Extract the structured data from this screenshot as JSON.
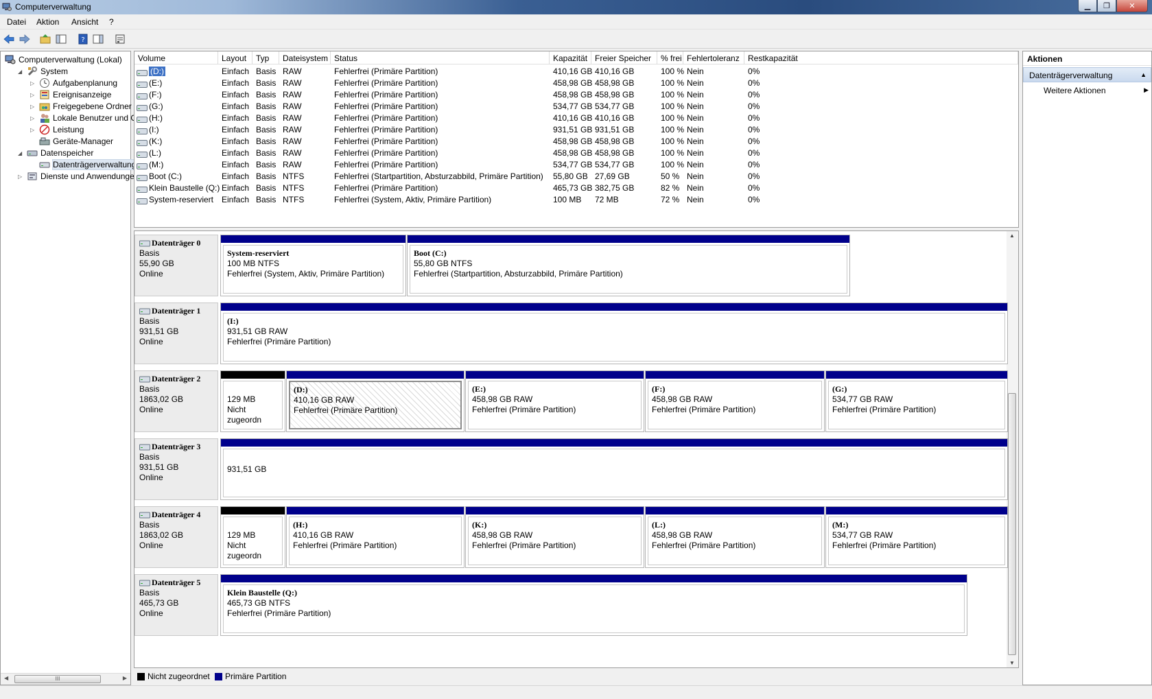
{
  "window": {
    "title": "Computerverwaltung"
  },
  "menu": {
    "items": [
      "Datei",
      "Aktion",
      "Ansicht",
      "?"
    ]
  },
  "tree": {
    "items": [
      {
        "label": "Computerverwaltung (Lokal)",
        "level": 0,
        "expander": "",
        "icon": "computer-icon"
      },
      {
        "label": "System",
        "level": 1,
        "expander": "◢",
        "icon": "tools-icon"
      },
      {
        "label": "Aufgabenplanung",
        "level": 2,
        "expander": "▷",
        "icon": "clock-icon"
      },
      {
        "label": "Ereignisanzeige",
        "level": 2,
        "expander": "▷",
        "icon": "event-viewer-icon"
      },
      {
        "label": "Freigegebene Ordner",
        "level": 2,
        "expander": "▷",
        "icon": "shared-folder-icon"
      },
      {
        "label": "Lokale Benutzer und Gr",
        "level": 2,
        "expander": "▷",
        "icon": "users-icon"
      },
      {
        "label": "Leistung",
        "level": 2,
        "expander": "▷",
        "icon": "performance-icon"
      },
      {
        "label": "Geräte-Manager",
        "level": 2,
        "expander": "",
        "icon": "device-manager-icon"
      },
      {
        "label": "Datenspeicher",
        "level": 1,
        "expander": "◢",
        "icon": "storage-icon"
      },
      {
        "label": "Datenträgerverwaltung",
        "level": 2,
        "expander": "",
        "icon": "disk-management-icon",
        "selected": true
      },
      {
        "label": "Dienste und Anwendungen",
        "level": 1,
        "expander": "▷",
        "icon": "services-icon"
      }
    ],
    "scroll_thumb_label": "III"
  },
  "volumes": {
    "columns": [
      "Volume",
      "Layout",
      "Typ",
      "Dateisystem",
      "Status",
      "Kapazität",
      "Freier Speicher",
      "% frei",
      "Fehlertoleranz",
      "Restkapazität"
    ],
    "rows": [
      {
        "volume": "(D:)",
        "layout": "Einfach",
        "typ": "Basis",
        "fs": "RAW",
        "status": "Fehlerfrei (Primäre Partition)",
        "cap": "410,16 GB",
        "free": "410,16 GB",
        "pct": "100 %",
        "ft": "Nein",
        "rest": "0%",
        "selected": true
      },
      {
        "volume": "(E:)",
        "layout": "Einfach",
        "typ": "Basis",
        "fs": "RAW",
        "status": "Fehlerfrei (Primäre Partition)",
        "cap": "458,98 GB",
        "free": "458,98 GB",
        "pct": "100 %",
        "ft": "Nein",
        "rest": "0%"
      },
      {
        "volume": "(F:)",
        "layout": "Einfach",
        "typ": "Basis",
        "fs": "RAW",
        "status": "Fehlerfrei (Primäre Partition)",
        "cap": "458,98 GB",
        "free": "458,98 GB",
        "pct": "100 %",
        "ft": "Nein",
        "rest": "0%"
      },
      {
        "volume": "(G:)",
        "layout": "Einfach",
        "typ": "Basis",
        "fs": "RAW",
        "status": "Fehlerfrei (Primäre Partition)",
        "cap": "534,77 GB",
        "free": "534,77 GB",
        "pct": "100 %",
        "ft": "Nein",
        "rest": "0%"
      },
      {
        "volume": "(H:)",
        "layout": "Einfach",
        "typ": "Basis",
        "fs": "RAW",
        "status": "Fehlerfrei (Primäre Partition)",
        "cap": "410,16 GB",
        "free": "410,16 GB",
        "pct": "100 %",
        "ft": "Nein",
        "rest": "0%"
      },
      {
        "volume": "(I:)",
        "layout": "Einfach",
        "typ": "Basis",
        "fs": "RAW",
        "status": "Fehlerfrei (Primäre Partition)",
        "cap": "931,51 GB",
        "free": "931,51 GB",
        "pct": "100 %",
        "ft": "Nein",
        "rest": "0%"
      },
      {
        "volume": "(K:)",
        "layout": "Einfach",
        "typ": "Basis",
        "fs": "RAW",
        "status": "Fehlerfrei (Primäre Partition)",
        "cap": "458,98 GB",
        "free": "458,98 GB",
        "pct": "100 %",
        "ft": "Nein",
        "rest": "0%"
      },
      {
        "volume": "(L:)",
        "layout": "Einfach",
        "typ": "Basis",
        "fs": "RAW",
        "status": "Fehlerfrei (Primäre Partition)",
        "cap": "458,98 GB",
        "free": "458,98 GB",
        "pct": "100 %",
        "ft": "Nein",
        "rest": "0%"
      },
      {
        "volume": "(M:)",
        "layout": "Einfach",
        "typ": "Basis",
        "fs": "RAW",
        "status": "Fehlerfrei (Primäre Partition)",
        "cap": "534,77 GB",
        "free": "534,77 GB",
        "pct": "100 %",
        "ft": "Nein",
        "rest": "0%"
      },
      {
        "volume": "Boot (C:)",
        "layout": "Einfach",
        "typ": "Basis",
        "fs": "NTFS",
        "status": "Fehlerfrei (Startpartition, Absturzabbild, Primäre Partition)",
        "cap": "55,80 GB",
        "free": "27,69 GB",
        "pct": "50 %",
        "ft": "Nein",
        "rest": "0%"
      },
      {
        "volume": "Klein Baustelle (Q:)",
        "layout": "Einfach",
        "typ": "Basis",
        "fs": "NTFS",
        "status": "Fehlerfrei (Primäre Partition)",
        "cap": "465,73 GB",
        "free": "382,75 GB",
        "pct": "82 %",
        "ft": "Nein",
        "rest": "0%"
      },
      {
        "volume": "System-reserviert",
        "layout": "Einfach",
        "typ": "Basis",
        "fs": "NTFS",
        "status": "Fehlerfrei (System, Aktiv, Primäre Partition)",
        "cap": "100 MB",
        "free": "72 MB",
        "pct": "72 %",
        "ft": "Nein",
        "rest": "0%"
      }
    ]
  },
  "disks": [
    {
      "name": "Datenträger 0",
      "type": "Basis",
      "size": "55,90 GB",
      "state": "Online",
      "partitions": [
        {
          "name": "System-reserviert",
          "size": "100 MB NTFS",
          "status": "Fehlerfrei (System, Aktiv, Primäre Partition)",
          "bar": "primary"
        },
        {
          "name": "Boot  (C:)",
          "size": "55,80 GB NTFS",
          "status": "Fehlerfrei (Startpartition, Absturzabbild, Primäre Partition)",
          "bar": "primary"
        }
      ]
    },
    {
      "name": "Datenträger 1",
      "type": "Basis",
      "size": "931,51 GB",
      "state": "Online",
      "partitions": [
        {
          "name": "(I:)",
          "size": "931,51 GB RAW",
          "status": "Fehlerfrei (Primäre Partition)",
          "bar": "primary"
        }
      ]
    },
    {
      "name": "Datenträger 2",
      "type": "Basis",
      "size": "1863,02 GB",
      "state": "Online",
      "partitions": [
        {
          "name": "",
          "size": "129 MB",
          "status": "Nicht zugeordn",
          "bar": "unallocated"
        },
        {
          "name": "(D:)",
          "size": "410,16 GB RAW",
          "status": "Fehlerfrei (Primäre Partition)",
          "bar": "primary",
          "selected": true
        },
        {
          "name": "(E:)",
          "size": "458,98 GB RAW",
          "status": "Fehlerfrei (Primäre Partition)",
          "bar": "primary"
        },
        {
          "name": "(F:)",
          "size": "458,98 GB RAW",
          "status": "Fehlerfrei (Primäre Partition)",
          "bar": "primary"
        },
        {
          "name": "(G:)",
          "size": "534,77 GB RAW",
          "status": "Fehlerfrei (Primäre Partition)",
          "bar": "primary"
        }
      ]
    },
    {
      "name": "Datenträger 3",
      "type": "Basis",
      "size": "931,51 GB",
      "state": "Online",
      "partitions": [
        {
          "name": "",
          "size": "931,51 GB",
          "status": "",
          "bar": "primary"
        }
      ]
    },
    {
      "name": "Datenträger 4",
      "type": "Basis",
      "size": "1863,02 GB",
      "state": "Online",
      "partitions": [
        {
          "name": "",
          "size": "129 MB",
          "status": "Nicht zugeordn",
          "bar": "unallocated"
        },
        {
          "name": "(H:)",
          "size": "410,16 GB RAW",
          "status": "Fehlerfrei (Primäre Partition)",
          "bar": "primary"
        },
        {
          "name": "(K:)",
          "size": "458,98 GB RAW",
          "status": "Fehlerfrei (Primäre Partition)",
          "bar": "primary"
        },
        {
          "name": "(L:)",
          "size": "458,98 GB RAW",
          "status": "Fehlerfrei (Primäre Partition)",
          "bar": "primary"
        },
        {
          "name": "(M:)",
          "size": "534,77 GB RAW",
          "status": "Fehlerfrei (Primäre Partition)",
          "bar": "primary"
        }
      ]
    },
    {
      "name": "Datenträger 5",
      "type": "Basis",
      "size": "465,73 GB",
      "state": "Online",
      "partitions": [
        {
          "name": "Klein Baustelle  (Q:)",
          "size": "465,73 GB NTFS",
          "status": "Fehlerfrei (Primäre Partition)",
          "bar": "primary"
        }
      ]
    }
  ],
  "legend": {
    "unallocated": "Nicht zugeordnet",
    "primary": "Primäre Partition"
  },
  "actions": {
    "title": "Aktionen",
    "section": "Datenträgerverwaltung",
    "more": "Weitere Aktionen"
  },
  "colors": {
    "primary_bar": "#00008b",
    "unallocated_bar": "#000000",
    "selection": "#3d71c5"
  }
}
